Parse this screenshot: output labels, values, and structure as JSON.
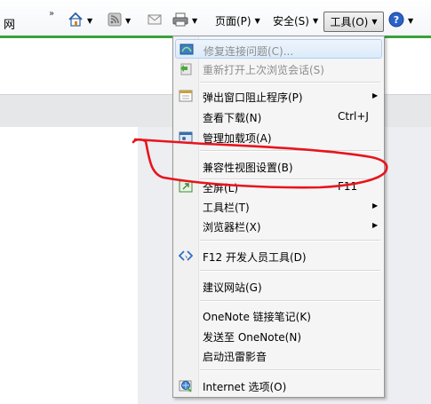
{
  "toolbar": {
    "left_text": "网",
    "overflow_chevron": "»",
    "page_label": "页面(P)",
    "safety_label": "安全(S)",
    "tools_label": "工具(O)",
    "icons": [
      "home-icon",
      "rss-feeds-icon",
      "read-mail-icon",
      "print-icon",
      "help-icon"
    ]
  },
  "menu": {
    "items": [
      {
        "label": "修复连接问题(C)...",
        "disabled": true,
        "icon": "diagnose-connection-icon"
      },
      {
        "label": "重新打开上次浏览会话(S)",
        "disabled": true,
        "icon": "reopen-session-icon"
      },
      {
        "label": "弹出窗口阻止程序(P)",
        "submenu": true,
        "icon": "popup-blocker-icon"
      },
      {
        "label": "查看下载(N)",
        "shortcut": "Ctrl+J"
      },
      {
        "label": "管理加载项(A)",
        "icon": "manage-addons-icon"
      },
      {
        "label": "兼容性视图设置(B)"
      },
      {
        "label": "全屏(L)",
        "shortcut": "F11",
        "icon": "fullscreen-icon"
      },
      {
        "label": "工具栏(T)",
        "submenu": true
      },
      {
        "label": "浏览器栏(X)",
        "submenu": true
      },
      {
        "label": "F12 开发人员工具(D)",
        "icon": "developer-tools-icon"
      },
      {
        "label": "建议网站(G)"
      },
      {
        "label": "OneNote 链接笔记(K)"
      },
      {
        "label": "发送至 OneNote(N)"
      },
      {
        "label": "启动迅雷影音"
      },
      {
        "label": "Internet 选项(O)",
        "icon": "internet-options-icon"
      }
    ]
  },
  "colors": {
    "accent_green": "#3aa13a",
    "annotation_red": "#e8141c",
    "menu_bg": "#f5f5f5"
  }
}
